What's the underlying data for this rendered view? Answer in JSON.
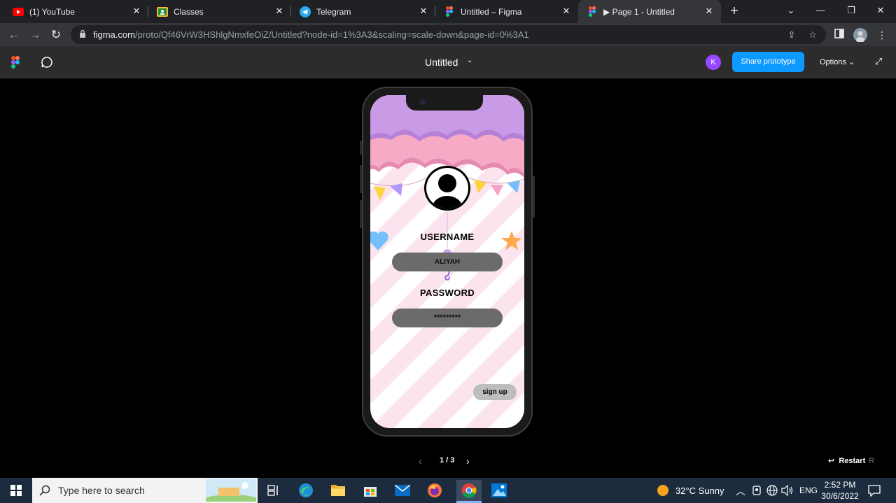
{
  "browser": {
    "tabs": [
      {
        "label": "(1) YouTube",
        "icon": "youtube-icon"
      },
      {
        "label": "Classes",
        "icon": "classroom-icon"
      },
      {
        "label": "Telegram",
        "icon": "telegram-icon"
      },
      {
        "label": "Untitled – Figma",
        "icon": "figma-icon"
      },
      {
        "label": "▶ Page 1 - Untitled",
        "icon": "figma-icon",
        "active": true
      }
    ],
    "url_host": "figma.com",
    "url_path": "/proto/Qf46VrW3HShlgNmxfeOiZ/Untitled?node-id=1%3A3&scaling=scale-down&page-id=0%3A1"
  },
  "figma": {
    "file_title": "Untitled",
    "avatar_initial": "K",
    "share_label": "Share prototype",
    "options_label": "Options",
    "pager": "1 / 3",
    "restart_label": "Restart",
    "restart_key": "R"
  },
  "prototype": {
    "username_label": "USERNAME",
    "username_value": "ALIYAH",
    "password_label": "PASSWORD",
    "password_value": "*********",
    "signup_label": "sign up"
  },
  "taskbar": {
    "search_placeholder": "Type here to search",
    "weather": "32°C  Sunny",
    "language": "ENG",
    "time": "2:52 PM",
    "date": "30/6/2022"
  },
  "colors": {
    "accent": "#0d99ff",
    "avatar": "#9747ff",
    "cloud_purple": "#c99be6",
    "cloud_pink": "#f6aac6",
    "stripe_pink": "#fce4ef"
  }
}
